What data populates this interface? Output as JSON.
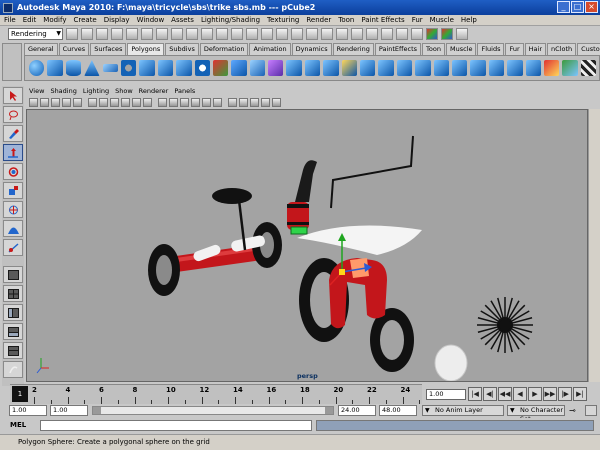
{
  "window": {
    "title": "Autodesk Maya 2010: F:\\maya\\tricycle\\sbs\\trike sbs.mb   ---   pCube2"
  },
  "menubar": [
    "File",
    "Edit",
    "Modify",
    "Create",
    "Display",
    "Window",
    "Assets",
    "Lighting/Shading",
    "Texturing",
    "Render",
    "Toon",
    "Paint Effects",
    "Fur",
    "Muscle",
    "Help"
  ],
  "statusline": {
    "menu_set": "Rendering"
  },
  "shelf": {
    "tabs": [
      "General",
      "Curves",
      "Surfaces",
      "Polygons",
      "Subdivs",
      "Deformation",
      "Animation",
      "Dynamics",
      "Rendering",
      "PaintEffects",
      "Toon",
      "Muscle",
      "Fluids",
      "Fur",
      "Hair",
      "nCloth",
      "Custom"
    ],
    "active_tab": "Polygons"
  },
  "viewport": {
    "menus": [
      "View",
      "Shading",
      "Lighting",
      "Show",
      "Renderer",
      "Panels"
    ],
    "camera_label": "persp"
  },
  "timeline": {
    "current_frame": "1",
    "ticks": [
      "2",
      "4",
      "6",
      "8",
      "10",
      "12",
      "14",
      "16",
      "18",
      "20",
      "22",
      "24"
    ],
    "current_time_field": "1.00"
  },
  "range": {
    "start_field": "1.00",
    "playback_start": "1.00",
    "playback_end": "24.00",
    "end_field": "48.00",
    "anim_layer": "No Anim Layer",
    "character_set": "No Character Set"
  },
  "commandline": {
    "label": "MEL"
  },
  "helpline": {
    "text": "Polygon Sphere: Create a polygonal sphere on the grid"
  },
  "colors": {
    "title_bar": "#1f5ec4",
    "viewport_bg": "#a3a3a3",
    "trike_red": "#c3161b",
    "tire_black": "#111111"
  }
}
